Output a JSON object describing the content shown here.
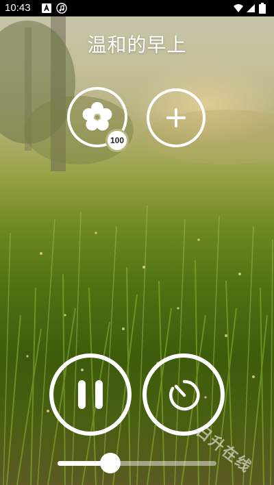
{
  "status_bar": {
    "time": "10:43",
    "icons": [
      "notification-a-icon",
      "music-note-icon",
      "wifi-icon",
      "signal-icon",
      "battery-icon"
    ]
  },
  "header": {
    "title": "温和的早上"
  },
  "scene_selector": {
    "badge_count": "100",
    "icon": "flower-icon"
  },
  "add_button": {
    "icon": "plus-icon"
  },
  "controls": {
    "pause_icon": "pause-icon",
    "timer_icon": "timer-icon"
  },
  "volume": {
    "level": 0.33
  },
  "watermark": "日升在线",
  "colors": {
    "foreground": "#ffffff",
    "status_bar_bg": "#000000"
  }
}
